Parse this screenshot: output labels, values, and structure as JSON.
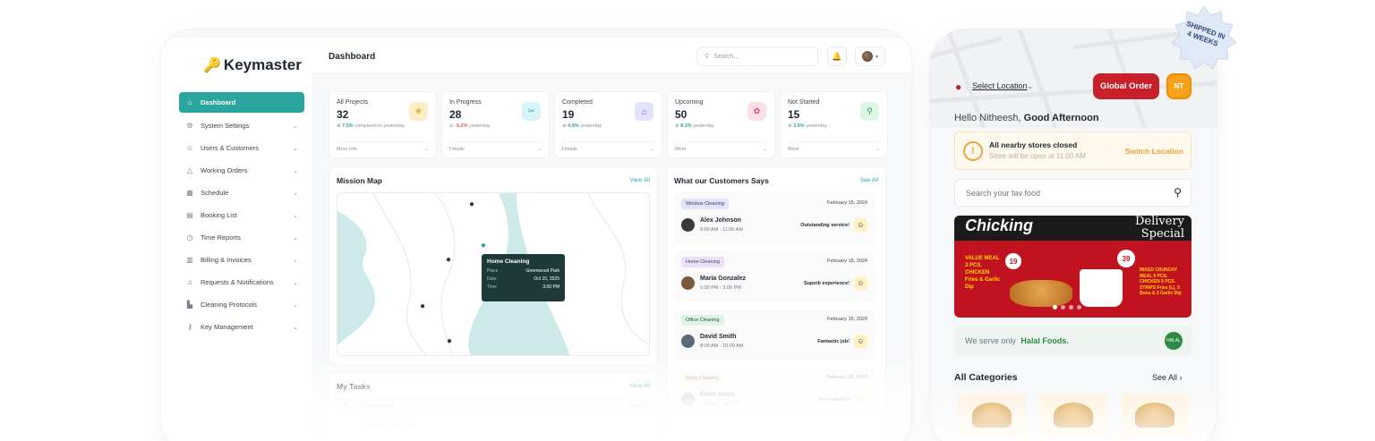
{
  "dashboard": {
    "logo": "Keymaster",
    "title": "Dashboard",
    "search_placeholder": "Search...",
    "nav": [
      {
        "label": "Dashboard",
        "icon": "home-icon",
        "active": true
      },
      {
        "label": "System Settings",
        "icon": "gear-icon"
      },
      {
        "label": "Users & Customers",
        "icon": "user-icon"
      },
      {
        "label": "Working Orders",
        "icon": "warning-icon"
      },
      {
        "label": "Schedule",
        "icon": "calendar-icon"
      },
      {
        "label": "Booking List",
        "icon": "calendar-check-icon"
      },
      {
        "label": "Time Reports",
        "icon": "clock-icon"
      },
      {
        "label": "Billing & Invoices",
        "icon": "invoice-icon"
      },
      {
        "label": "Requests & Notifications",
        "icon": "bell-icon"
      },
      {
        "label": "Cleaning Protocols",
        "icon": "chart-icon"
      },
      {
        "label": "Key Management",
        "icon": "key-icon"
      }
    ],
    "stats": [
      {
        "label": "All Projects",
        "value": "32",
        "change": "7.5%",
        "change_text": " compared to yesterday",
        "foot": "More info",
        "icon_color": "#fdeec9",
        "glyph_color": "#e0a81c",
        "negative": false
      },
      {
        "label": "In Progress",
        "value": "28",
        "change": "-5.2%",
        "change_text": " yesterday",
        "foot": "Details",
        "icon_color": "#d7f5f8",
        "glyph_color": "#27a8b8",
        "negative": true
      },
      {
        "label": "Completed",
        "value": "19",
        "change": "4.9%",
        "change_text": " yesterday",
        "foot": "Details",
        "icon_color": "#e3e2fb",
        "glyph_color": "#5a54d6",
        "negative": false
      },
      {
        "label": "Upcoming",
        "value": "50",
        "change": "8.3%",
        "change_text": " yesterday",
        "foot": "More",
        "icon_color": "#fde0e6",
        "glyph_color": "#e0446a",
        "negative": false
      },
      {
        "label": "Not Started",
        "value": "15",
        "change": "3.6%",
        "change_text": " yesterday",
        "foot": "More",
        "icon_color": "#ddf6e5",
        "glyph_color": "#32a35a",
        "negative": false
      }
    ],
    "map": {
      "title": "Mission Map",
      "link": "View All",
      "tooltip": {
        "title": "Home Cleaning",
        "rows": [
          {
            "k": "Place",
            "v": "Greenwood Park"
          },
          {
            "k": "Date",
            "v": "Oct 15, 2025"
          },
          {
            "k": "Time",
            "v": "3:00 PM"
          }
        ]
      }
    },
    "reviews": {
      "title": "What our Customers Says",
      "link": "See All",
      "items": [
        {
          "tag": "Window Cleaning",
          "tag_color": "#dfe3fb",
          "date": "February 15, 2024",
          "name": "Alex Johnson",
          "time": "9:00 AM - 11:00 AM",
          "comment": "Outstanding service!",
          "avatar": "#3a3a3a"
        },
        {
          "tag": "Home Cleaning",
          "tag_color": "#ecdffb",
          "date": "February 15, 2024",
          "name": "Maria Gonzalez",
          "time": "1:00 PM - 3:00 PM",
          "comment": "Superb experience!",
          "avatar": "#7a5a3a"
        },
        {
          "tag": "Office Cleaning",
          "tag_color": "#dff5e3",
          "date": "February 15, 2024",
          "name": "David Smith",
          "time": "8:00 AM - 10:00 AM",
          "comment": "Fantastic job!",
          "avatar": "#5a6a7a"
        },
        {
          "tag": "Deep Cleaning",
          "tag_color": "#fdebd6",
          "date": "February 15, 2024",
          "name": "Emily Davis",
          "time": "2:00 PM - 4:00 PM",
          "comment": "Very satisfied",
          "avatar": "#8a8a8a"
        }
      ]
    },
    "tasks": {
      "title": "My Tasks",
      "link": "View All",
      "header": {
        "num": "#",
        "task": "Cleaning Task",
        "status": "Status"
      },
      "row": "Cleaning Living Room"
    }
  },
  "phone": {
    "location": "Select Location",
    "global_order": "Global Order",
    "initials": "NT",
    "greeting_prefix": "Hello Nitheesh, ",
    "greeting_bold": "Good Afternoon",
    "closed_title": "All nearby stores closed",
    "closed_sub": "Store will be open at 11:00 AM",
    "switch_location": "Switch Location",
    "search_placeholder": "Search your fav food",
    "banner": {
      "brand": "Chicking",
      "delivery": "Delivery",
      "special": "Special",
      "deal1": "VALUE MEAL 3 PCS. CHICKEN Fries & Garlic Dip",
      "price1": "19",
      "deal2": "MIXED CRUNCHY MEAL 5 PCS. CHICKEN 5 PCS. STRIPS Fries (L), 3 Buns & 3 Garlic Dip",
      "price2": "39"
    },
    "halal_prefix": "We serve only",
    "halal_bold": "Halal Foods.",
    "halal_badge": "HALAL",
    "categories_title": "All Categories",
    "see_all": "See All"
  },
  "badge": {
    "line1": "SHIPPED IN",
    "line2": "4 WEEKS"
  }
}
